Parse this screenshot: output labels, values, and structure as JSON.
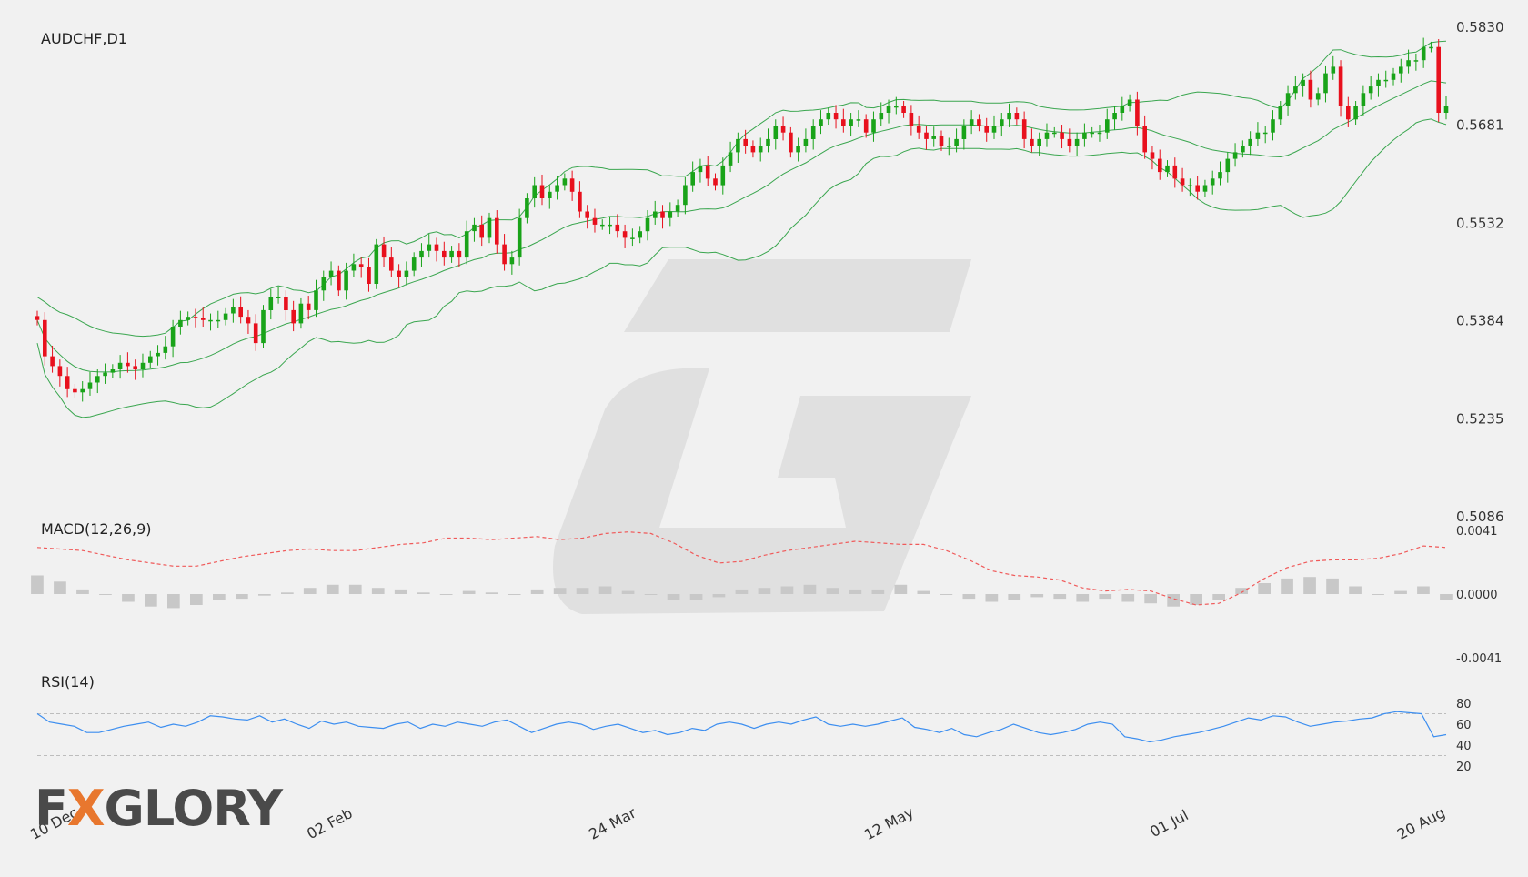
{
  "colors": {
    "up": "#19a319",
    "down": "#e8101d",
    "bollinger": "#3aa64f",
    "macd_signal": "#f05a5a",
    "macd_hist": "#c8c8c8",
    "rsi": "#3c8ef0",
    "rsi_levels": "#bdbdbd",
    "watermark": "#d9d9d9",
    "logo_accent": "#e8772e"
  },
  "logo": {
    "text": "FXGLORY",
    "accent_letter": "X"
  },
  "chart_data": {
    "type": "candlestick",
    "symbol_label": "AUDCHF,D1",
    "x_labels": [
      "10 Dec",
      "02 Feb",
      "24 Mar",
      "12 May",
      "01 Jul",
      "20 Aug"
    ],
    "price_axis": {
      "min": 0.5086,
      "max": 0.583,
      "ticks": [
        "0.5830",
        "0.5681",
        "0.5532",
        "0.5384",
        "0.5235",
        "0.5086"
      ]
    },
    "price_closes": [
      0.5385,
      0.533,
      0.5315,
      0.53,
      0.528,
      0.5275,
      0.528,
      0.529,
      0.53,
      0.5305,
      0.531,
      0.532,
      0.5315,
      0.531,
      0.532,
      0.533,
      0.5335,
      0.5345,
      0.5375,
      0.5385,
      0.539,
      0.5388,
      0.5385,
      0.5385,
      0.5385,
      0.5395,
      0.5405,
      0.539,
      0.538,
      0.535,
      0.54,
      0.542,
      0.542,
      0.54,
      0.538,
      0.541,
      0.54,
      0.543,
      0.545,
      0.546,
      0.543,
      0.546,
      0.547,
      0.5465,
      0.544,
      0.55,
      0.548,
      0.546,
      0.545,
      0.546,
      0.548,
      0.549,
      0.55,
      0.549,
      0.548,
      0.549,
      0.548,
      0.552,
      0.553,
      0.551,
      0.554,
      0.55,
      0.547,
      0.548,
      0.554,
      0.557,
      0.559,
      0.557,
      0.558,
      0.559,
      0.56,
      0.558,
      0.555,
      0.554,
      0.553,
      0.553,
      0.553,
      0.552,
      0.551,
      0.551,
      0.552,
      0.554,
      0.555,
      0.554,
      0.555,
      0.556,
      0.559,
      0.561,
      0.562,
      0.56,
      0.559,
      0.562,
      0.564,
      0.566,
      0.565,
      0.564,
      0.565,
      0.566,
      0.568,
      0.567,
      0.564,
      0.565,
      0.566,
      0.568,
      0.569,
      0.57,
      0.569,
      0.568,
      0.569,
      0.569,
      0.567,
      0.569,
      0.57,
      0.571,
      0.571,
      0.57,
      0.568,
      0.567,
      0.566,
      0.5665,
      0.565,
      0.565,
      0.566,
      0.568,
      0.569,
      0.568,
      0.567,
      0.568,
      0.569,
      0.57,
      0.569,
      0.566,
      0.565,
      0.566,
      0.567,
      0.567,
      0.566,
      0.565,
      0.566,
      0.567,
      0.567,
      0.567,
      0.569,
      0.57,
      0.571,
      0.572,
      0.568,
      0.564,
      0.563,
      0.561,
      0.562,
      0.56,
      0.559,
      0.559,
      0.558,
      0.559,
      0.56,
      0.561,
      0.563,
      0.564,
      0.565,
      0.566,
      0.567,
      0.567,
      0.569,
      0.571,
      0.573,
      0.574,
      0.575,
      0.572,
      0.573,
      0.576,
      0.577,
      0.571,
      0.569,
      0.571,
      0.573,
      0.574,
      0.575,
      0.575,
      0.576,
      0.577,
      0.578,
      0.578,
      0.58,
      0.58,
      0.57,
      0.571
    ],
    "macd": {
      "label": "MACD(12,26,9)",
      "ticks": [
        "0.0041",
        "0.0000",
        "-0.0041"
      ],
      "signal": [
        0.003,
        0.0029,
        0.0028,
        0.0025,
        0.0022,
        0.002,
        0.0018,
        0.0018,
        0.0021,
        0.0024,
        0.0026,
        0.0028,
        0.0029,
        0.0028,
        0.0028,
        0.003,
        0.0032,
        0.0033,
        0.0036,
        0.0036,
        0.0035,
        0.0036,
        0.0037,
        0.0035,
        0.0036,
        0.0039,
        0.004,
        0.0039,
        0.0033,
        0.0025,
        0.002,
        0.0021,
        0.0025,
        0.0028,
        0.003,
        0.0032,
        0.0034,
        0.0033,
        0.0032,
        0.0032,
        0.0028,
        0.0022,
        0.0015,
        0.0012,
        0.0011,
        0.0009,
        0.0004,
        0.0002,
        0.0003,
        0.0002,
        -0.0003,
        -0.0007,
        -0.0006,
        0.0001,
        0.001,
        0.0017,
        0.0021,
        0.0022,
        0.0022,
        0.0023,
        0.0026,
        0.0031,
        0.003
      ],
      "histogram": [
        0.0012,
        0.0008,
        0.0003,
        0.0,
        -0.0005,
        -0.0008,
        -0.0009,
        -0.0007,
        -0.0004,
        -0.0003,
        -0.0001,
        0.0001,
        0.0004,
        0.0006,
        0.0006,
        0.0004,
        0.0003,
        0.0001,
        0.0,
        0.0002,
        0.0001,
        0.0,
        0.0003,
        0.0004,
        0.0004,
        0.0005,
        0.0002,
        0.0,
        -0.0004,
        -0.0004,
        -0.0002,
        0.0003,
        0.0004,
        0.0005,
        0.0006,
        0.0004,
        0.0003,
        0.0003,
        0.0006,
        0.0002,
        0.0,
        -0.0003,
        -0.0005,
        -0.0004,
        -0.0002,
        -0.0003,
        -0.0005,
        -0.0003,
        -0.0005,
        -0.0006,
        -0.0008,
        -0.0007,
        -0.0004,
        0.0004,
        0.0007,
        0.001,
        0.0011,
        0.001,
        0.0005,
        0.0,
        0.0002,
        0.0005,
        -0.0004
      ]
    },
    "rsi": {
      "label": "RSI(14)",
      "levels": [
        70,
        30
      ],
      "ticks": [
        "80",
        "60",
        "40",
        "20"
      ],
      "values": [
        70,
        62,
        60,
        58,
        52,
        52,
        55,
        58,
        60,
        62,
        57,
        60,
        58,
        62,
        68,
        67,
        65,
        64,
        68,
        62,
        65,
        60,
        56,
        63,
        60,
        62,
        58,
        57,
        56,
        60,
        62,
        56,
        60,
        58,
        62,
        60,
        58,
        62,
        64,
        58,
        52,
        56,
        60,
        62,
        60,
        55,
        58,
        60,
        56,
        52,
        54,
        50,
        52,
        56,
        54,
        60,
        62,
        60,
        56,
        60,
        62,
        60,
        64,
        67,
        60,
        58,
        60,
        58,
        60,
        63,
        66,
        57,
        55,
        52,
        56,
        50,
        48,
        52,
        55,
        60,
        56,
        52,
        50,
        52,
        55,
        60,
        62,
        60,
        48,
        46,
        43,
        45,
        48,
        50,
        52,
        55,
        58,
        62,
        66,
        64,
        68,
        67,
        62,
        58,
        60,
        62,
        63,
        65,
        66,
        70,
        72,
        71,
        70,
        48,
        50
      ]
    }
  }
}
